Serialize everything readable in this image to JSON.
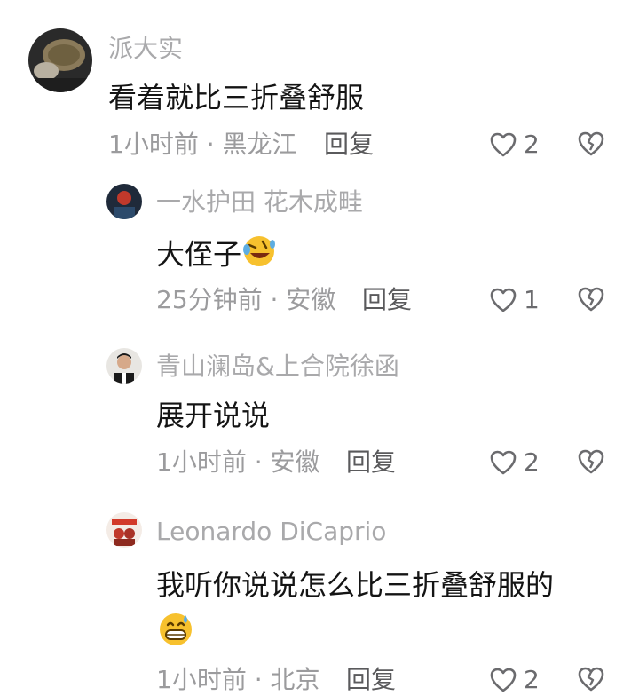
{
  "comments": [
    {
      "user": "派大实",
      "text": "看着就比三折叠舒服",
      "time": "1小时前",
      "location": "黑龙江",
      "reply_label": "回复",
      "likes": "2"
    },
    {
      "user": "一水护田 花木成畦",
      "text": "大侄子",
      "emoji": "rolling-laughing-emoji",
      "time": "25分钟前",
      "location": "安徽",
      "reply_label": "回复",
      "likes": "1"
    },
    {
      "user": "青山澜岛&上合院徐函",
      "text": "展开说说",
      "time": "1小时前",
      "location": "安徽",
      "reply_label": "回复",
      "likes": "2"
    },
    {
      "user": "Leonardo DiCaprio",
      "text": "我听你说说怎么比三折叠舒服的",
      "emoji": "sweat-grin-emoji",
      "time": "1小时前",
      "location": "北京",
      "reply_label": "回复",
      "likes": "2"
    }
  ],
  "separator": "·",
  "colors": {
    "name": "#a9a9ab",
    "text": "#141414",
    "meta": "#9b9b9d",
    "icon": "#6b6b6e"
  }
}
